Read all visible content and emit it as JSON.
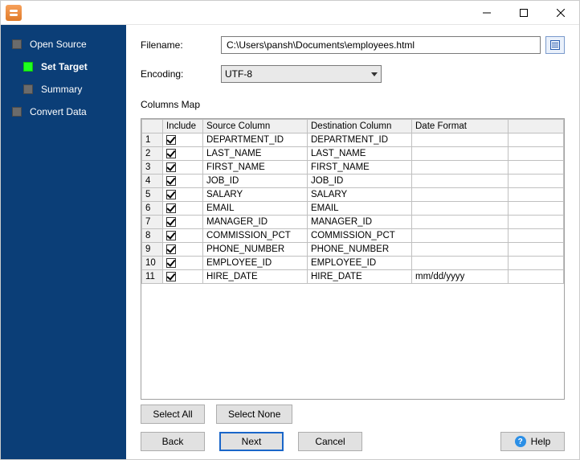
{
  "form": {
    "filename_label": "Filename:",
    "filename_value": "C:\\Users\\pansh\\Documents\\employees.html",
    "encoding_label": "Encoding:",
    "encoding_value": "UTF-8",
    "columns_map_label": "Columns Map"
  },
  "sidebar": {
    "items": [
      {
        "label": "Open Source",
        "active": false
      },
      {
        "label": "Set Target",
        "active": true
      },
      {
        "label": "Summary",
        "active": false
      },
      {
        "label": "Convert Data",
        "active": false
      }
    ]
  },
  "grid": {
    "headers": {
      "include": "Include",
      "source": "Source Column",
      "dest": "Destination Column",
      "datefmt": "Date Format"
    },
    "rows": [
      {
        "n": "1",
        "include": true,
        "source": "DEPARTMENT_ID",
        "dest": "DEPARTMENT_ID",
        "datefmt": ""
      },
      {
        "n": "2",
        "include": true,
        "source": "LAST_NAME",
        "dest": "LAST_NAME",
        "datefmt": ""
      },
      {
        "n": "3",
        "include": true,
        "source": "FIRST_NAME",
        "dest": "FIRST_NAME",
        "datefmt": ""
      },
      {
        "n": "4",
        "include": true,
        "source": "JOB_ID",
        "dest": "JOB_ID",
        "datefmt": ""
      },
      {
        "n": "5",
        "include": true,
        "source": "SALARY",
        "dest": "SALARY",
        "datefmt": ""
      },
      {
        "n": "6",
        "include": true,
        "source": "EMAIL",
        "dest": "EMAIL",
        "datefmt": ""
      },
      {
        "n": "7",
        "include": true,
        "source": "MANAGER_ID",
        "dest": "MANAGER_ID",
        "datefmt": ""
      },
      {
        "n": "8",
        "include": true,
        "source": "COMMISSION_PCT",
        "dest": "COMMISSION_PCT",
        "datefmt": ""
      },
      {
        "n": "9",
        "include": true,
        "source": "PHONE_NUMBER",
        "dest": "PHONE_NUMBER",
        "datefmt": ""
      },
      {
        "n": "10",
        "include": true,
        "source": "EMPLOYEE_ID",
        "dest": "EMPLOYEE_ID",
        "datefmt": ""
      },
      {
        "n": "11",
        "include": true,
        "source": "HIRE_DATE",
        "dest": "HIRE_DATE",
        "datefmt": "mm/dd/yyyy"
      }
    ]
  },
  "buttons": {
    "select_all": "Select All",
    "select_none": "Select None",
    "back": "Back",
    "next": "Next",
    "cancel": "Cancel",
    "help": "Help"
  }
}
